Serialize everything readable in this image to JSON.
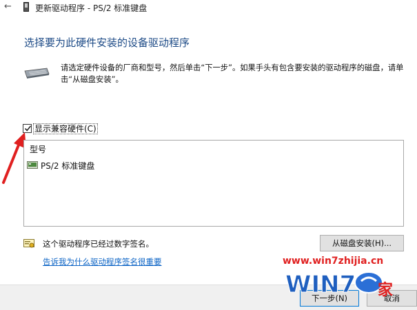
{
  "titlebar": {
    "title": "更新驱动程序 - PS/2 标准键盘"
  },
  "heading": "选择要为此硬件安装的设备驱动程序",
  "instructions": "请选定硬件设备的厂商和型号，然后单击“下一步”。如果手头有包含要安装的驱动程序的磁盘，请单击“从磁盘安装”。",
  "compat_checkbox": {
    "label": "显示兼容硬件(C)",
    "checked": true
  },
  "model_list": {
    "header": "型号",
    "items": [
      {
        "label": "PS/2 标准键盘"
      }
    ]
  },
  "signature": {
    "text": "这个驱动程序已经过数字签名。",
    "link": "告诉我为什么驱动程序签名很重要"
  },
  "buttons": {
    "have_disk": "从磁盘安装(H)...",
    "next": "下一步(N)",
    "cancel": "取消"
  },
  "watermark": {
    "url": "www.win7zhijia.cn",
    "logo_text": "WIN7",
    "logo_suffix": "之家"
  },
  "colors": {
    "heading": "#1c4a86",
    "link": "#0b63c5",
    "annotation_arrow": "#e02020",
    "footer": "#f0f0f0"
  }
}
